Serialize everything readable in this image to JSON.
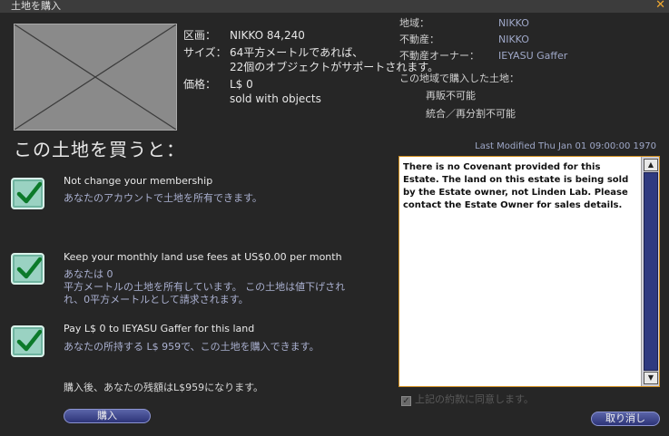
{
  "window": {
    "title": "土地を購入"
  },
  "parcel": {
    "name_label": "区画：",
    "name_value": "NIKKO 84,240",
    "size_label": "サイズ：",
    "size_line1": "64平方メートルであれば、",
    "size_line2": "22個のオブジェクトがサポートされます。",
    "price_label": "価格：",
    "price_value": "L$ 0",
    "price_note": "sold with objects"
  },
  "region_info": {
    "region_label": "地域：",
    "region_value": "NIKKO",
    "estate_label": "不動産：",
    "estate_value": "NIKKO",
    "owner_label": "不動産オーナー：",
    "owner_value": "IEYASU Gaffer",
    "purchased_label": "この地域で購入した土地：",
    "resale": "再販不可能",
    "join_split": "統合／再分割不可能"
  },
  "heading": "この土地を買うと：",
  "items": [
    {
      "title": "Not change your membership",
      "desc": [
        "あなたのアカウントで土地を所有できます。"
      ]
    },
    {
      "title": "Keep your monthly land use fees at US$0.00 per month",
      "desc": [
        "あなたは 0",
        "平方メートルの土地を所有しています。 この土地は値下げされ",
        "れ、0平方メートルとして請求されます。"
      ]
    },
    {
      "title": "Pay L$ 0 to IEYASU Gaffer for this land",
      "desc": [
        "あなたの所持する L$ 959で、この土地を購入できます。"
      ]
    }
  ],
  "after_purchase": "購入後、あなたの残額はL$959になります。",
  "buttons": {
    "buy": "購入",
    "cancel": "取り消し"
  },
  "covenant": {
    "last_modified": "Last Modified Thu Jan 01 09:00:00 1970",
    "text": "There is no Covenant provided for this Estate. The land on this estate is being sold by the Estate owner, not Linden Lab.  Please contact the Estate Owner for sales details.",
    "agree_label": "上記の約款に同意します。"
  }
}
